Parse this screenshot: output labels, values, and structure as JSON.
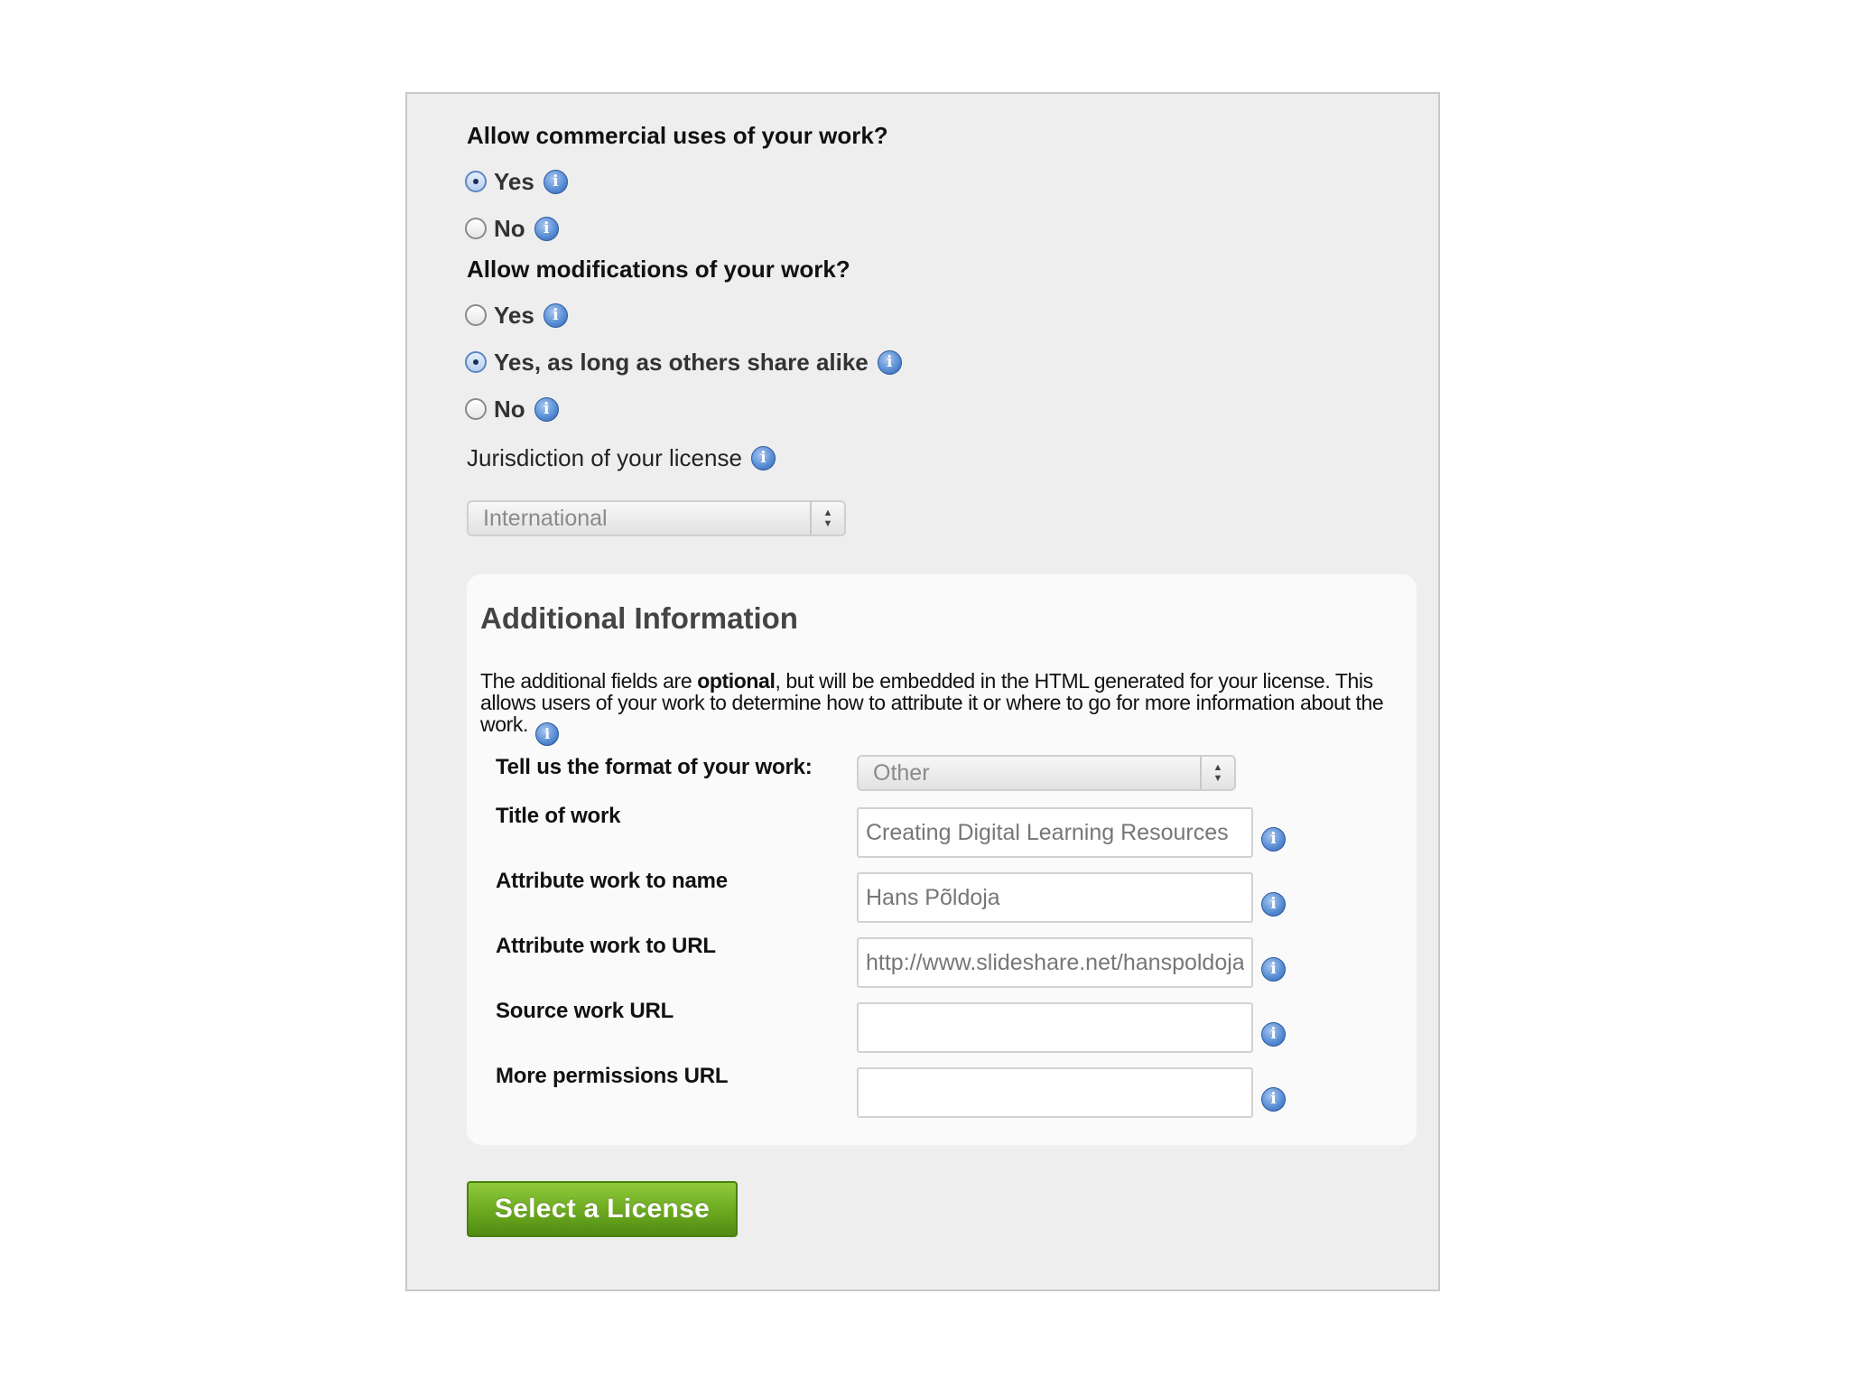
{
  "commercial": {
    "question": "Allow commercial uses of your work?",
    "options": [
      {
        "label": "Yes",
        "selected": true
      },
      {
        "label": "No",
        "selected": false
      }
    ]
  },
  "modifications": {
    "question": "Allow modifications of your work?",
    "options": [
      {
        "label": "Yes",
        "selected": false
      },
      {
        "label": "Yes, as long as others share alike",
        "selected": true
      },
      {
        "label": "No",
        "selected": false
      }
    ]
  },
  "jurisdiction": {
    "label": "Jurisdiction of your license",
    "selected": "International"
  },
  "additional": {
    "title": "Additional Information",
    "text_before": "The additional fields are ",
    "text_bold": "optional",
    "text_after": ", but will be embedded in the HTML generated for your license. This allows users of your work to determine how to attribute it or where to go for more information about the work.",
    "format_label": "Tell us the format of your work:",
    "format_value": "Other",
    "fields": [
      {
        "label": "Title of work",
        "value": "Creating Digital Learning Resources"
      },
      {
        "label": "Attribute work to name",
        "value": "Hans Põldoja"
      },
      {
        "label": "Attribute work to URL",
        "value": "http://www.slideshare.net/hanspoldoja"
      },
      {
        "label": "Source work URL",
        "value": ""
      },
      {
        "label": "More permissions URL",
        "value": ""
      }
    ]
  },
  "submit_label": "Select a License",
  "icons": {
    "info": "info-icon",
    "radio": "radio-button",
    "select_arrows": "updown-arrows-icon"
  },
  "colors": {
    "panel_bg": "#eeeeee",
    "button_green": "#6ca81f",
    "info_blue": "#5a8fd6"
  }
}
